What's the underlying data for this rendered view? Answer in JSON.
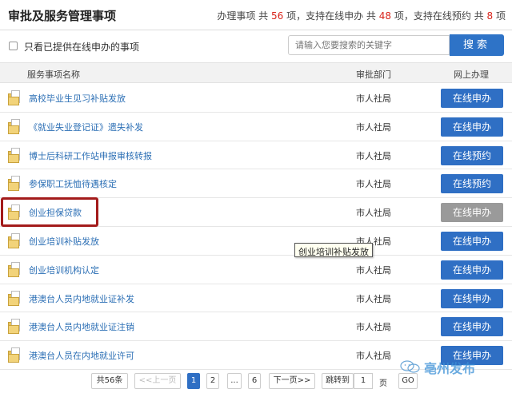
{
  "header": {
    "title": "审批及服务管理事项",
    "stats_prefix": "办理事项 共",
    "total": "56",
    "stats_mid1": "项，支持在线申办 共",
    "online_count": "48",
    "stats_mid2": "项，支持在线预约 共",
    "booking_count": "8",
    "stats_suffix": "项"
  },
  "filter": {
    "checkbox_label": "只看已提供在线申办的事项",
    "checked": false
  },
  "search": {
    "placeholder": "请输入您要搜索的关键字",
    "button_label": "搜索"
  },
  "table": {
    "columns": [
      "服务事项名称",
      "审批部门",
      "网上办理"
    ],
    "rows": [
      {
        "name": "高校毕业生见习补贴发放",
        "dept": "市人社局",
        "action": "在线申办",
        "enabled": true
      },
      {
        "name": "《就业失业登记证》遗失补发",
        "dept": "市人社局",
        "action": "在线申办",
        "enabled": true
      },
      {
        "name": "博士后科研工作站申报审核转报",
        "dept": "市人社局",
        "action": "在线预约",
        "enabled": true
      },
      {
        "name": "参保职工抚恤待遇核定",
        "dept": "市人社局",
        "action": "在线预约",
        "enabled": true
      },
      {
        "name": "创业担保贷款",
        "dept": "市人社局",
        "action": "在线申办",
        "enabled": false
      },
      {
        "name": "创业培训补贴发放",
        "dept": "市人社局",
        "action": "在线申办",
        "enabled": true
      },
      {
        "name": "创业培训机构认定",
        "dept": "市人社局",
        "action": "在线申办",
        "enabled": true
      },
      {
        "name": "港澳台人员内地就业证补发",
        "dept": "市人社局",
        "action": "在线申办",
        "enabled": true
      },
      {
        "name": "港澳台人员内地就业证注销",
        "dept": "市人社局",
        "action": "在线申办",
        "enabled": true
      },
      {
        "name": "港澳台人员在内地就业许可",
        "dept": "市人社局",
        "action": "在线申办",
        "enabled": true
      }
    ]
  },
  "tooltip": {
    "text": "创业培训补贴发放"
  },
  "pagination": {
    "total_label": "共56条",
    "prev_label": "<<上一页",
    "pages": [
      "1",
      "2",
      "...",
      "6"
    ],
    "current_page": "1",
    "next_label": "下一页>>",
    "goto_label": "跳转到",
    "goto_value": "1",
    "page_unit": "页",
    "go_label": "GO"
  },
  "watermark": {
    "text": "亳州发布"
  },
  "colors": {
    "primary_button": "#2f6fc4",
    "disabled_button": "#9a9a9a",
    "highlight_count": "#d9251c",
    "link_text": "#2c6fb5",
    "highlight_box": "#a31b1b"
  }
}
